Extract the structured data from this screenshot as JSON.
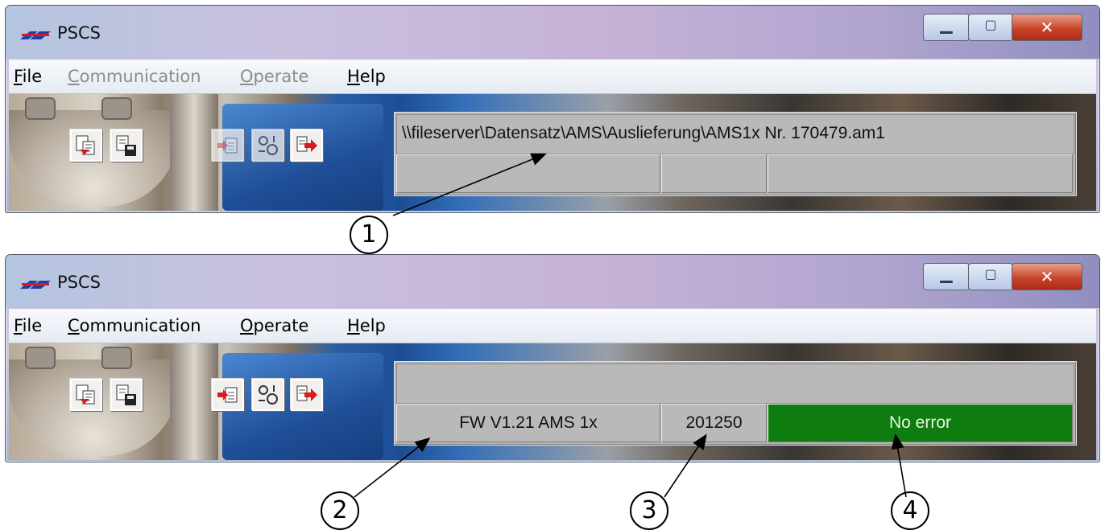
{
  "windows": [
    {
      "title": "PSCS",
      "menu": [
        {
          "label": "File",
          "hotkey": "F",
          "rest": "ile",
          "enabled": true
        },
        {
          "label": "Communication",
          "hotkey": "C",
          "rest": "ommunication",
          "enabled": false
        },
        {
          "label": "Operate",
          "hotkey": "O",
          "rest": "perate",
          "enabled": false
        },
        {
          "label": "Help",
          "hotkey": "H",
          "rest": "elp",
          "enabled": true
        }
      ],
      "path": "\\\\fileserver\\Datensatz\\AMS\\Auslieferung\\AMS1x Nr. 170479.am1",
      "firmware": "",
      "serial": "",
      "status": "",
      "buttons_enabled": {
        "comm": false
      }
    },
    {
      "title": "PSCS",
      "menu": [
        {
          "label": "File",
          "hotkey": "F",
          "rest": "ile",
          "enabled": true
        },
        {
          "label": "Communication",
          "hotkey": "C",
          "rest": "ommunication",
          "enabled": true
        },
        {
          "label": "Operate",
          "hotkey": "O",
          "rest": "perate",
          "enabled": true
        },
        {
          "label": "Help",
          "hotkey": "H",
          "rest": "elp",
          "enabled": true
        }
      ],
      "path": "",
      "firmware": "FW  V1.21 AMS 1x",
      "serial": "201250",
      "status": "No error",
      "buttons_enabled": {
        "comm": true
      }
    }
  ],
  "callouts": [
    "①",
    "②",
    "③",
    "④"
  ],
  "icons": {
    "app": "pscs-logo-icon",
    "open": "open-file-icon",
    "save": "save-file-icon",
    "download": "download-to-device-icon",
    "settings": "device-parameters-icon",
    "exit": "exit-icon"
  },
  "colors": {
    "status_ok": "#0e7c0e",
    "panel": "#b9b9b9",
    "close_button": "#c8452a"
  }
}
